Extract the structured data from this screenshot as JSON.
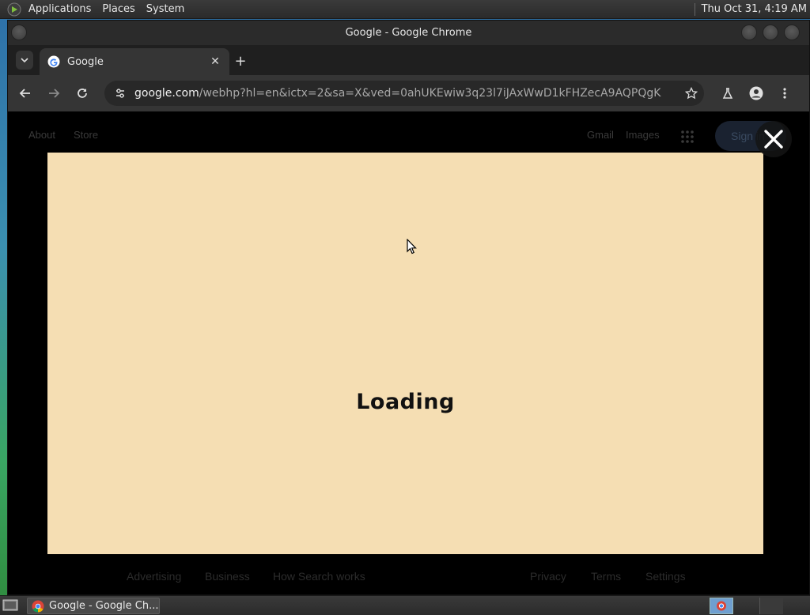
{
  "top_panel": {
    "menus": [
      "Applications",
      "Places",
      "System"
    ],
    "clock": "Thu Oct 31,  4:19 AM"
  },
  "window": {
    "title": "Google - Google Chrome"
  },
  "tab": {
    "title": "Google",
    "close": "✕",
    "new_tab": "+"
  },
  "toolbar": {
    "url_host": "google.com",
    "url_path": "/webhp?hl=en&ictx=2&sa=X&ved=0ahUKEwiw3q23l7iJAxWwD1kFHZecA9AQPQgK"
  },
  "page": {
    "header_links": [
      "About",
      "Store",
      "Gmail",
      "Images"
    ],
    "sign_in": "Sign in",
    "loading_text": "Loading",
    "footer_left": [
      "Advertising",
      "Business",
      "How Search works"
    ],
    "footer_right": [
      "Privacy",
      "Terms",
      "Settings"
    ],
    "doodle_bg": "#f5deb3"
  },
  "taskbar": {
    "task_label": "Google - Google Ch..."
  }
}
